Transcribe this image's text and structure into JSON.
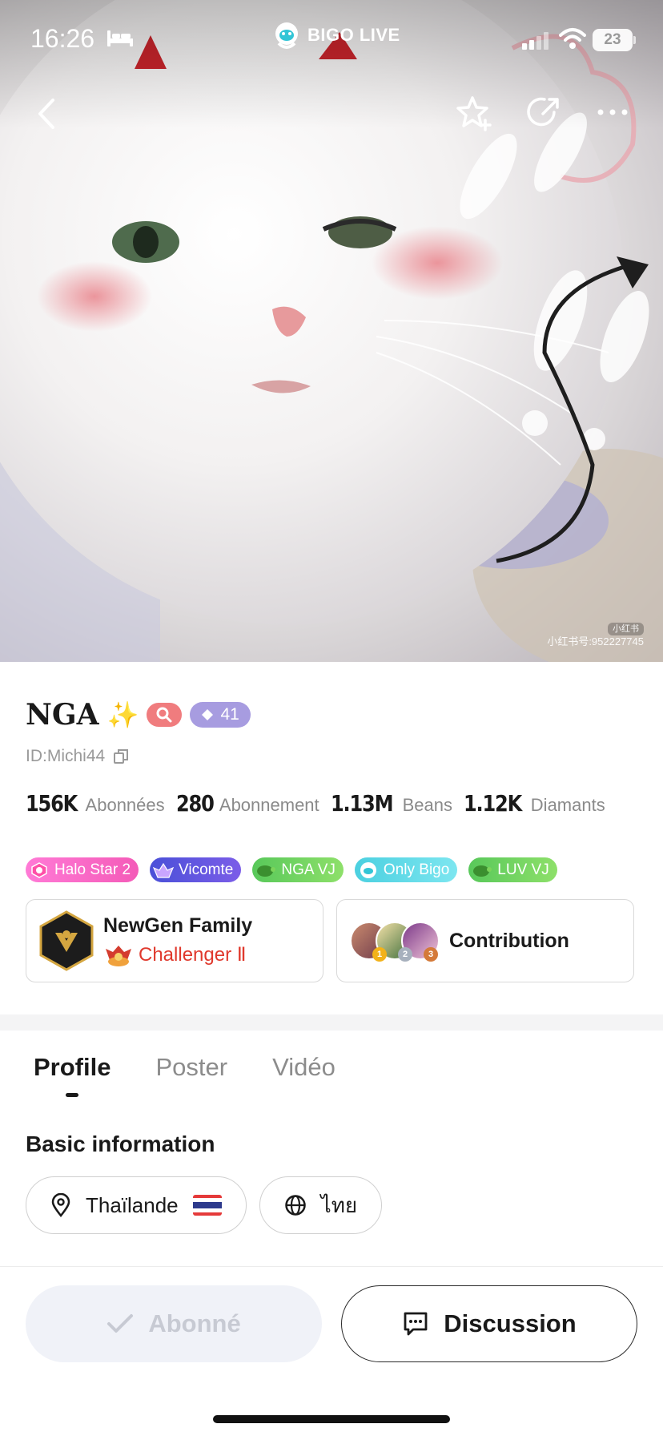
{
  "status_bar": {
    "time": "16:26",
    "battery": "23",
    "app_brand": "BIGO LIVE"
  },
  "hero": {
    "watermark_logo": "小红书",
    "watermark_text": "小红书号:952227745"
  },
  "profile": {
    "name": "NGA",
    "sparkle": "✨",
    "level": "41",
    "id": "ID:Michi44"
  },
  "stats": [
    {
      "value": "156K",
      "label": "Abonnées"
    },
    {
      "value": "280",
      "label": "Abonnement"
    },
    {
      "value": "1.13M",
      "label": "Beans"
    },
    {
      "value": "1.12K",
      "label": "Diamants"
    }
  ],
  "badges": [
    {
      "label": "Halo Star 2",
      "icon": "halo-star-icon"
    },
    {
      "label": "Vicomte",
      "icon": "vicomte-crest-icon"
    },
    {
      "label": "NGA VJ",
      "icon": "turtle-icon"
    },
    {
      "label": "Only Bigo",
      "icon": "bigo-mascot-icon"
    },
    {
      "label": "LUV VJ",
      "icon": "turtle-icon"
    }
  ],
  "family": {
    "name": "NewGen Family",
    "rank": "Challenger Ⅱ"
  },
  "contribution": {
    "label": "Contribution",
    "ranks": [
      "1",
      "2",
      "3"
    ]
  },
  "tabs": [
    {
      "label": "Profile",
      "active": true
    },
    {
      "label": "Poster",
      "active": false
    },
    {
      "label": "Vidéo",
      "active": false
    }
  ],
  "basic_info": {
    "title": "Basic information",
    "location": "Thaïlande",
    "language": "ไทย"
  },
  "actions": {
    "subscribed_label": "Abonné",
    "chat_label": "Discussion"
  },
  "colors": {
    "accent_red": "#e0392d",
    "level_badge": "#a79ce0",
    "search_badge": "#f07c7e",
    "subscribed_bg": "#f0f2f8"
  }
}
